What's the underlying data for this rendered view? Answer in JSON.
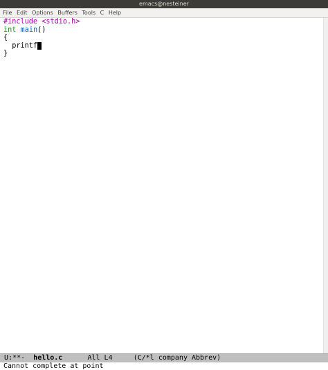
{
  "window": {
    "title": "emacs@nesteiner"
  },
  "menubar": [
    "File",
    "Edit",
    "Options",
    "Buffers",
    "Tools",
    "C",
    "Help"
  ],
  "editor": {
    "line1": {
      "directive": "#include",
      "header": "<stdio.h>"
    },
    "line2": {
      "type": "int",
      "func": "main",
      "parens": "()"
    },
    "line3": "{",
    "line4": "  printf",
    "line5": "}"
  },
  "modeline": {
    "status": "U:**-",
    "buffer": "hello.c",
    "position": "All L4",
    "modes": "(C/*l company Abbrev)"
  },
  "minibuffer": {
    "message": "Cannot complete at point"
  }
}
